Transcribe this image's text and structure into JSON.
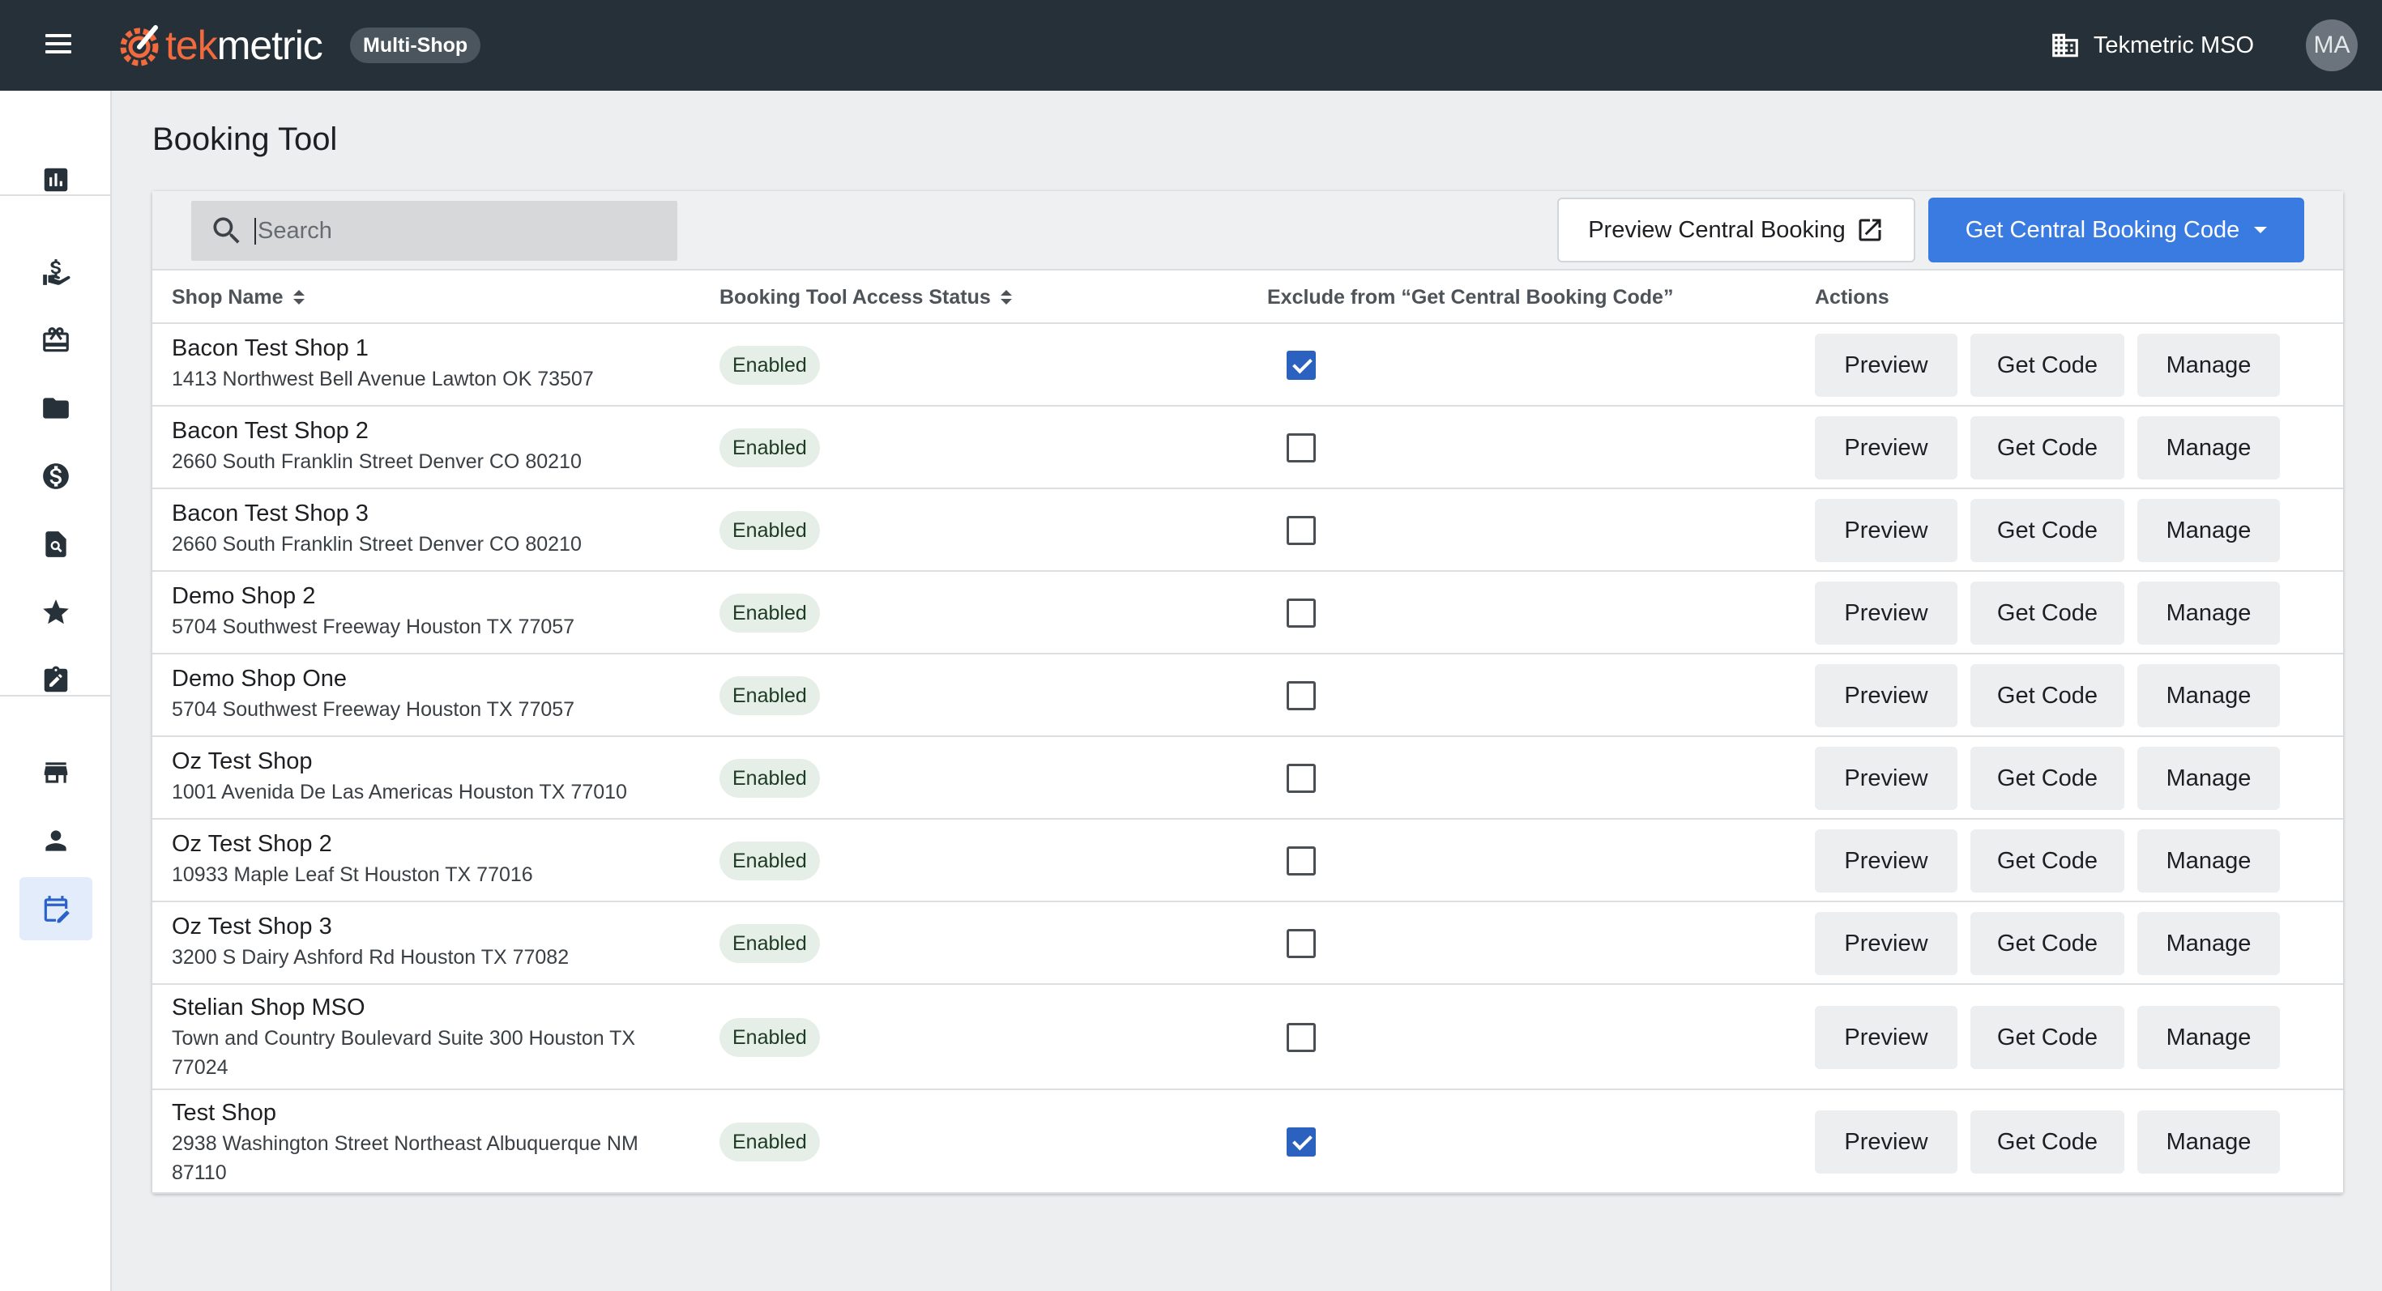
{
  "header": {
    "logo_text_1": "tek",
    "logo_text_2": "metric",
    "badge": "Multi-Shop",
    "org_name": "Tekmetric MSO",
    "avatar_initials": "MA",
    "brand_color": "#f26a3d"
  },
  "sidebar": {
    "items": [
      {
        "icon": "bar-chart-icon"
      },
      {
        "icon": "money-hand-icon"
      },
      {
        "icon": "gift-card-icon"
      },
      {
        "icon": "folder-icon"
      },
      {
        "icon": "dollar-circle-icon"
      },
      {
        "icon": "document-search-icon"
      },
      {
        "icon": "star-icon"
      },
      {
        "icon": "clipboard-edit-icon"
      },
      {
        "icon": "store-icon"
      },
      {
        "icon": "person-icon"
      },
      {
        "icon": "calendar-edit-icon",
        "active": true
      }
    ]
  },
  "page": {
    "title": "Booking Tool"
  },
  "toolbar": {
    "search_placeholder": "Search",
    "preview_central_label": "Preview Central Booking",
    "get_central_code_label": "Get Central Booking Code",
    "accent": "#3a7be2"
  },
  "table": {
    "columns": {
      "shop_name": "Shop Name",
      "status": "Booking Tool Access Status",
      "exclude": "Exclude from “Get Central Booking Code”",
      "actions": "Actions"
    },
    "action_labels": {
      "preview": "Preview",
      "get_code": "Get Code",
      "manage": "Manage"
    },
    "rows": [
      {
        "name": "Bacon Test Shop 1",
        "address": "1413 Northwest Bell Avenue Lawton OK 73507",
        "status": "Enabled",
        "excluded": true
      },
      {
        "name": "Bacon Test Shop 2",
        "address": "2660 South Franklin Street Denver CO 80210",
        "status": "Enabled",
        "excluded": false
      },
      {
        "name": "Bacon Test Shop 3",
        "address": "2660 South Franklin Street Denver CO 80210",
        "status": "Enabled",
        "excluded": false
      },
      {
        "name": "Demo Shop 2",
        "address": "5704 Southwest Freeway Houston TX 77057",
        "status": "Enabled",
        "excluded": false
      },
      {
        "name": "Demo Shop One",
        "address": "5704 Southwest Freeway Houston TX 77057",
        "status": "Enabled",
        "excluded": false
      },
      {
        "name": "Oz Test Shop",
        "address": "1001 Avenida De Las Americas Houston TX 77010",
        "status": "Enabled",
        "excluded": false
      },
      {
        "name": "Oz Test Shop 2",
        "address": "10933 Maple Leaf St Houston TX 77016",
        "status": "Enabled",
        "excluded": false
      },
      {
        "name": "Oz Test Shop 3",
        "address": "3200 S Dairy Ashford Rd Houston TX 77082",
        "status": "Enabled",
        "excluded": false
      },
      {
        "name": "Stelian Shop MSO",
        "address": "Town and Country Boulevard Suite 300 Houston TX 77024",
        "status": "Enabled",
        "excluded": false
      },
      {
        "name": "Test Shop",
        "address": "2938 Washington Street Northeast Albuquerque NM 87110",
        "status": "Enabled",
        "excluded": true
      }
    ]
  }
}
